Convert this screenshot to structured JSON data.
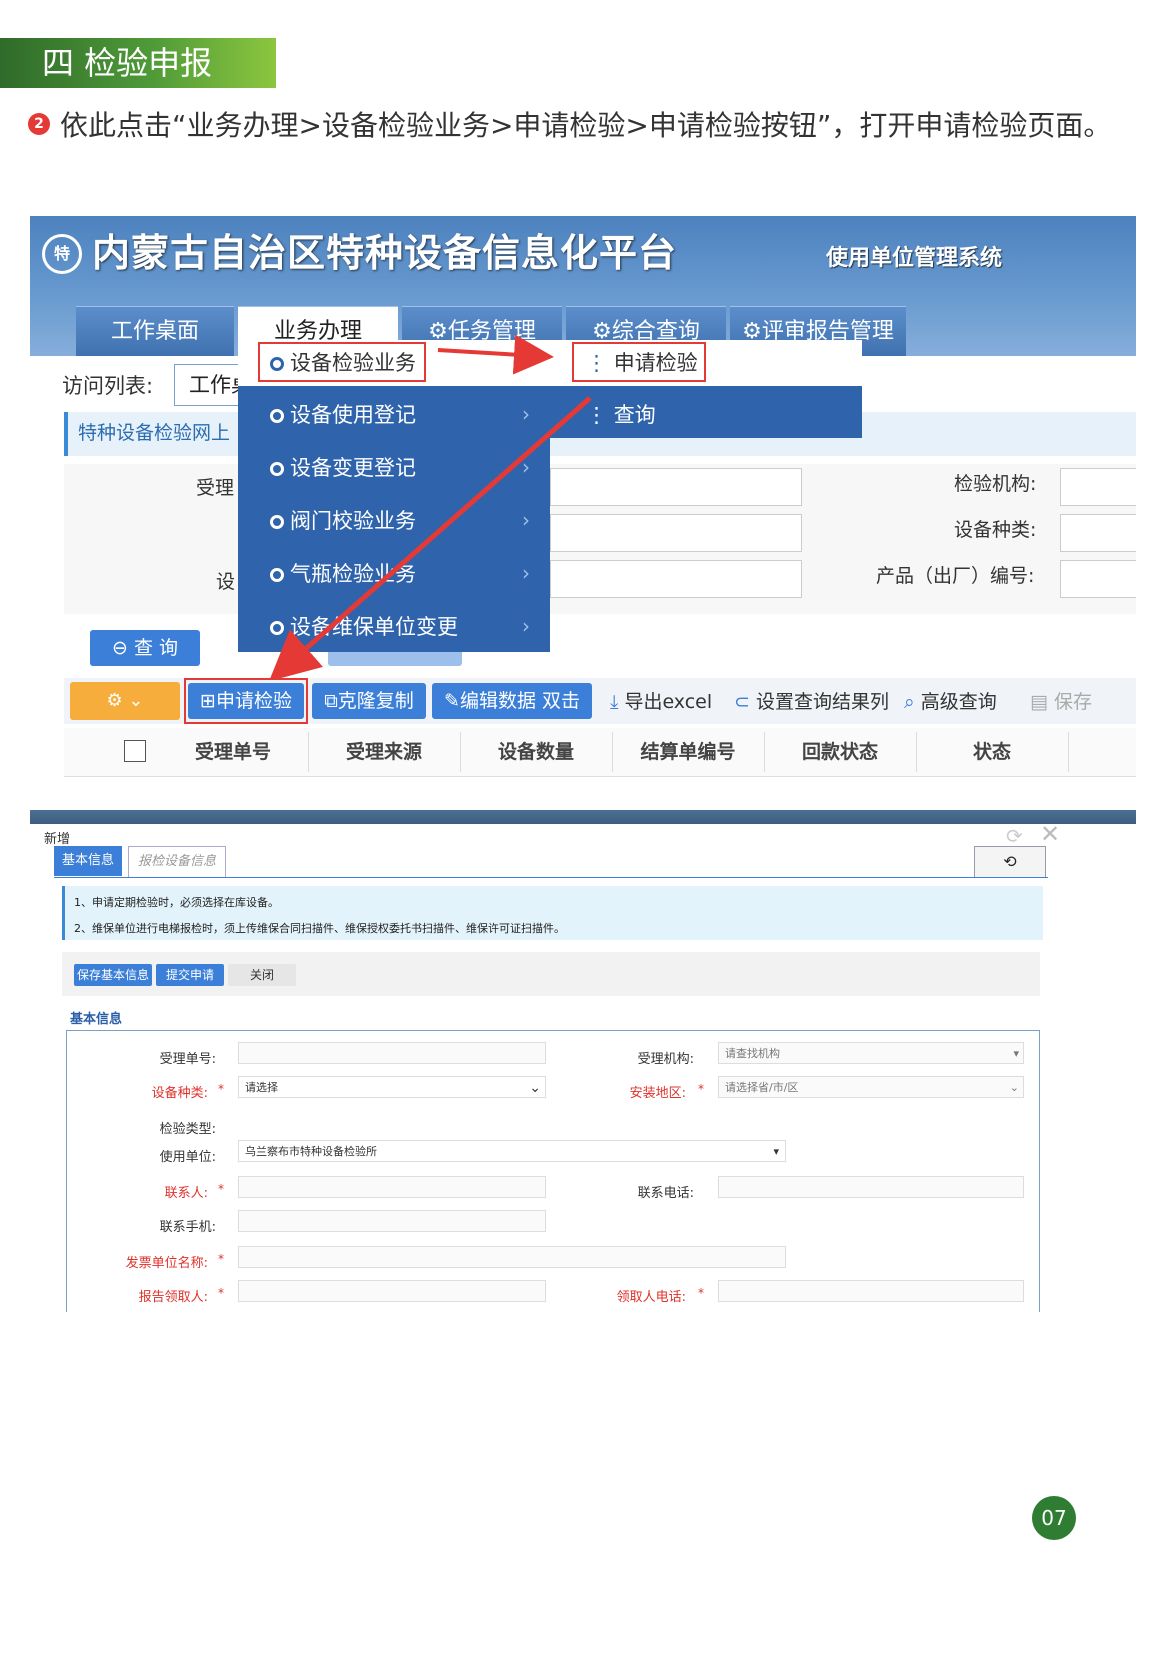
{
  "section": {
    "title": "四 检验申报"
  },
  "instruction": {
    "badge": "2",
    "text": "依此点击“业务办理>设备检验业务>申请检验>申请检验按钮”，打开申请检验页面。"
  },
  "shot1": {
    "platform_title": "内蒙古自治区特种设备信息化平台",
    "platform_subtitle": "使用单位管理系统",
    "logo_text": "特",
    "nav_tabs": [
      "工作桌面",
      "业务办理",
      "任务管理",
      "综合查询",
      "评审报告管理"
    ],
    "visit_label": "访问列表:",
    "visit_tab": "工作桌",
    "breadcrumb": "特种设备检验网上",
    "menu": [
      "设备检验业务",
      "设备使用登记",
      "设备变更登记",
      "阀门校验业务",
      "气瓶检验业务",
      "设备维保单位变更"
    ],
    "submenu": [
      "申请检验",
      "查询"
    ],
    "search_labels": {
      "left1": "受理",
      "left2": "设",
      "right1": "检验机构:",
      "right2": "设备种类:",
      "right3": "产品（出厂）编号:"
    },
    "query_button": "查 询",
    "toolbar": {
      "apply": "申请检验",
      "clone": "克隆复制",
      "edit": "编辑数据 双击",
      "export": "导出excel",
      "set_columns": "设置查询结果列",
      "advanced": "高级查询",
      "save": "保存"
    },
    "grid_headers": [
      "受理单号",
      "受理来源",
      "设备数量",
      "结算单编号",
      "回款状态",
      "状态"
    ]
  },
  "shot2": {
    "dialog_title": "新增",
    "tabs": [
      "基本信息",
      "报检设备信息"
    ],
    "notes": [
      "1、申请定期检验时，必须选择在库设备。",
      "2、维保单位进行电梯报检时，须上传维保合同扫描件、维保授权委托书扫描件、维保许可证扫描件。"
    ],
    "buttons": {
      "save": "保存基本信息",
      "submit": "提交申请",
      "close": "关闭"
    },
    "section_title": "基本信息",
    "fields": {
      "accept_no": "受理单号:",
      "accept_org": "受理机构:",
      "accept_org_placeholder": "请查找机构",
      "equip_type": "设备种类:",
      "equip_type_value": "请选择",
      "install_area": "安装地区:",
      "install_area_placeholder": "请选择省/市/区",
      "inspect_type": "检验类型:",
      "use_unit": "使用单位:",
      "use_unit_value": "乌兰察布市特种设备检验所",
      "contact": "联系人:",
      "contact_phone": "联系电话:",
      "mobile": "联系手机:",
      "invoice_unit": "发票单位名称:",
      "report_receiver": "报告领取人:",
      "receiver_phone": "领取人电话:",
      "required_mark": "*"
    }
  },
  "page_number": "07",
  "colors": {
    "accent_green": "#2e7d32",
    "nav_blue": "#3f71b0",
    "red": "#e53935"
  }
}
